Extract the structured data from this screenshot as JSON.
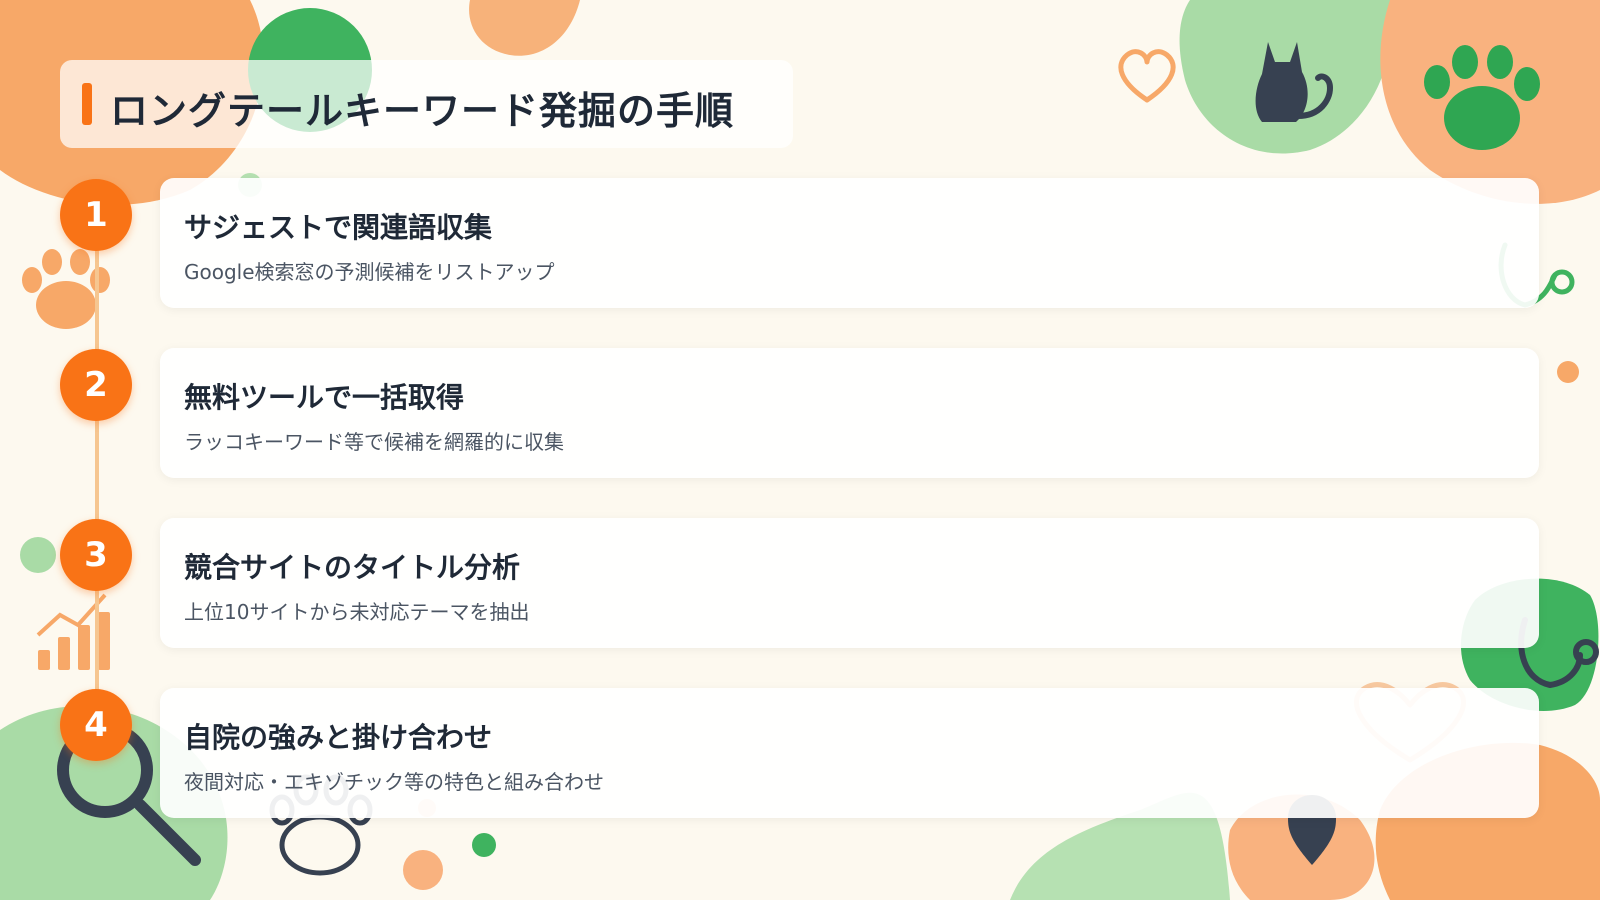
{
  "slide": {
    "title": "ロングテールキーワード発掘の手順",
    "accent_color": "#f97316",
    "steps": [
      {
        "num": "1",
        "title": "サジェストで関連語収集",
        "desc": "Google検索窓の予測候補をリストアップ"
      },
      {
        "num": "2",
        "title": "無料ツールで一括取得",
        "desc": "ラッコキーワード等で候補を網羅的に収集"
      },
      {
        "num": "3",
        "title": "競合サイトのタイトル分析",
        "desc": "上位10サイトから未対応テーマを抽出"
      },
      {
        "num": "4",
        "title": "自院の強みと掛け合わせ",
        "desc": "夜間対応・エキゾチック等の特色と組み合わせ"
      }
    ]
  },
  "decorations": [
    "cat-icon",
    "paw-icon",
    "heart-icon",
    "stethoscope-icon",
    "chart-icon",
    "magnifier-icon",
    "location-pin-icon"
  ]
}
